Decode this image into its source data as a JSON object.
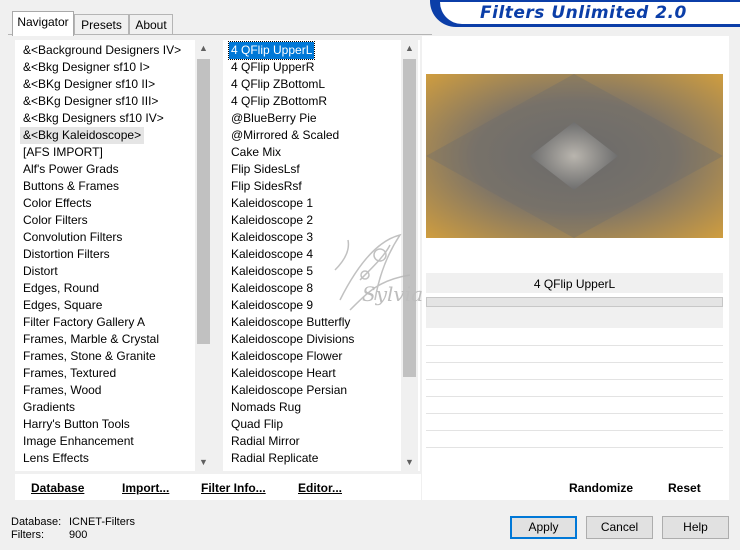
{
  "tabs": [
    "Navigator",
    "Presets",
    "About"
  ],
  "title": "Filters Unlimited 2.0",
  "categories": [
    "&<Background Designers IV>",
    "&<Bkg Designer sf10 I>",
    "&<BKg Designer sf10 II>",
    "&<BKg Designer sf10 III>",
    "&<Bkg Designers sf10 IV>",
    "&<Bkg Kaleidoscope>",
    "[AFS IMPORT]",
    "Alf's Power Grads",
    "Buttons & Frames",
    "Color Effects",
    "Color Filters",
    "Convolution Filters",
    "Distortion Filters",
    "Distort",
    "Edges, Round",
    "Edges, Square",
    "Filter Factory Gallery A",
    "Frames, Marble & Crystal",
    "Frames, Stone & Granite",
    "Frames, Textured",
    "Frames, Wood",
    "Gradients",
    "Harry's Button Tools",
    "Image Enhancement",
    "Lens Effects"
  ],
  "selected_category_index": 5,
  "filters": [
    "4 QFlip UpperL",
    "4 QFlip UpperR",
    "4 QFlip ZBottomL",
    "4 QFlip ZBottomR",
    "@BlueBerry Pie",
    "@Mirrored & Scaled",
    "Cake Mix",
    "Flip SidesLsf",
    "Flip SidesRsf",
    "Kaleidoscope 1",
    "Kaleidoscope 2",
    "Kaleidoscope 3",
    "Kaleidoscope 4",
    "Kaleidoscope 5",
    "Kaleidoscope 8",
    "Kaleidoscope 9",
    "Kaleidoscope Butterfly",
    "Kaleidoscope Divisions",
    "Kaleidoscope Flower",
    "Kaleidoscope Heart",
    "Kaleidoscope Persian",
    "Nomads Rug",
    "Quad Flip",
    "Radial Mirror",
    "Radial Replicate"
  ],
  "selected_filter_index": 0,
  "preview": {
    "filter_name": "4 QFlip UpperL",
    "colors": {
      "orange": "#d9a23a",
      "grey": "#6e6e6e",
      "light": "#b9b5ae"
    }
  },
  "watermark": "Sylviane",
  "buttons": {
    "database": "Database",
    "import": "Import...",
    "filter_info": "Filter Info...",
    "editor": "Editor...",
    "randomize": "Randomize",
    "reset": "Reset",
    "apply": "Apply",
    "cancel": "Cancel",
    "help": "Help"
  },
  "info": {
    "database_label": "Database:",
    "database_value": "ICNET-Filters",
    "filters_label": "Filters:",
    "filters_value": "900"
  },
  "scroll_icons": {
    "up": "chevron-up-icon",
    "down": "chevron-down-icon"
  },
  "accent_color": "#0b3ea8"
}
